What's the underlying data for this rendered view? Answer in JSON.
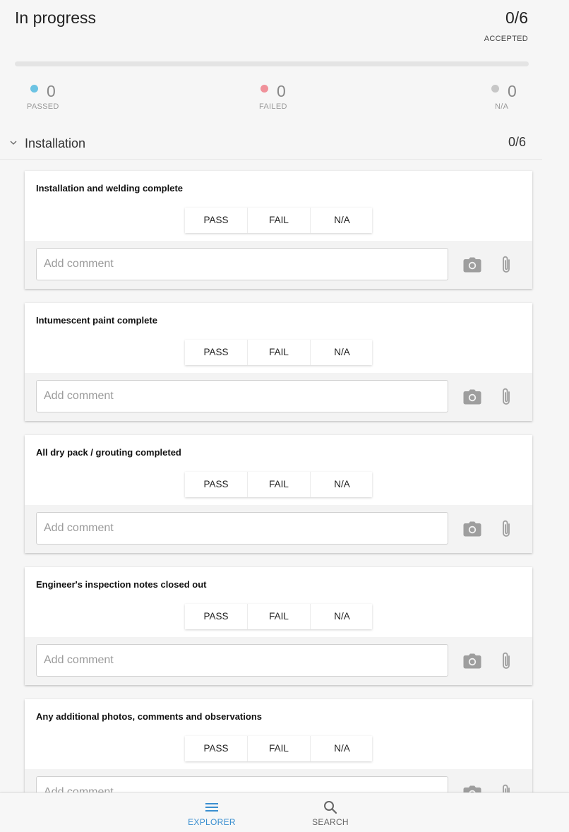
{
  "summary": {
    "status": "In progress",
    "accepted_count": "0/6",
    "accepted_label": "ACCEPTED",
    "progress_fraction": 0,
    "stats": [
      {
        "value": "0",
        "label": "PASSED",
        "color": "#6cc3e3"
      },
      {
        "value": "0",
        "label": "FAILED",
        "color": "#f0919a"
      },
      {
        "value": "0",
        "label": "N/A",
        "color": "#c7c7c7"
      }
    ]
  },
  "section": {
    "title": "Installation",
    "count": "0/6",
    "icon": "chevron-down-icon"
  },
  "items": [
    {
      "title": "Installation and welding complete"
    },
    {
      "title": "Intumescent paint complete"
    },
    {
      "title": "All dry pack / grouting completed"
    },
    {
      "title": "Engineer's inspection notes closed out"
    },
    {
      "title": "Any additional photos, comments and observations"
    }
  ],
  "item_controls": {
    "pass_label": "PASS",
    "fail_label": "FAIL",
    "na_label": "N/A",
    "comment_placeholder": "Add comment",
    "camera_icon": "camera-icon",
    "attach_icon": "paperclip-icon"
  },
  "bottom_nav": {
    "items": [
      {
        "label": "EXPLORER",
        "icon": "menu-icon",
        "active": true,
        "color": "#3a8fd0"
      },
      {
        "label": "SEARCH",
        "icon": "search-icon",
        "active": false,
        "color": "#666666"
      }
    ]
  }
}
